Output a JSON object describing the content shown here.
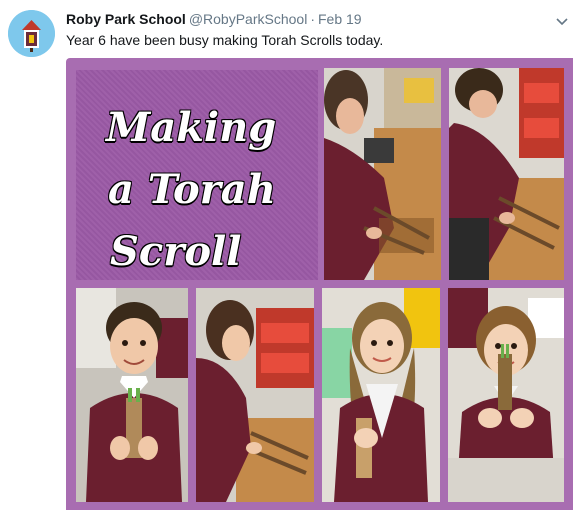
{
  "author": {
    "name": "Roby Park School",
    "handle": "@RobyParkSchool",
    "separator": "·",
    "timestamp": "Feb 19"
  },
  "icons": {
    "avatar": "school-logo",
    "more": "chevron-down-icon"
  },
  "tweet": {
    "text": "Year 6 have been busy making Torah Scrolls today."
  },
  "media": {
    "title_lines": [
      "Making",
      "a Torah",
      "Scroll"
    ],
    "photos": [
      "photo-boy-rolling-scroll",
      "photo-boy-building-scroll",
      "photo-boy-holding-scroll",
      "photo-girl-rolling-scroll",
      "photo-girl-holding-scroll",
      "photo-girl-smiling-with-scroll"
    ]
  },
  "colors": {
    "collage_background": "#a86db1",
    "title_panel": "#9b5aa6",
    "text_primary": "#14171a",
    "text_secondary": "#657786",
    "avatar_background": "#7ec8ec"
  }
}
